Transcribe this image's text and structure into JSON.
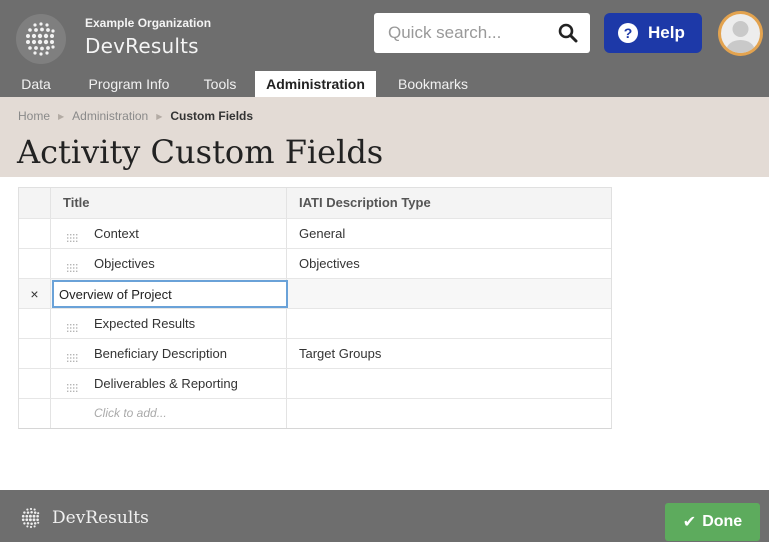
{
  "header": {
    "org_name": "Example Organization",
    "app_name": "DevResults",
    "search_placeholder": "Quick search...",
    "help_label": "Help"
  },
  "nav": {
    "items": [
      {
        "label": "Data",
        "active": false
      },
      {
        "label": "Program Info",
        "active": false
      },
      {
        "label": "Tools",
        "active": false
      },
      {
        "label": "Administration",
        "active": true
      },
      {
        "label": "Bookmarks",
        "active": false
      }
    ]
  },
  "breadcrumb": {
    "items": [
      "Home",
      "Administration",
      "Custom Fields"
    ]
  },
  "page": {
    "title": "Activity Custom Fields"
  },
  "table": {
    "columns": [
      "Title",
      "IATI Description Type"
    ],
    "rows": [
      {
        "title": "Context",
        "type": "General"
      },
      {
        "title": "Objectives",
        "type": "Objectives"
      },
      {
        "title": "Overview of Project",
        "type": "",
        "editing": true
      },
      {
        "title": "Expected Results",
        "type": ""
      },
      {
        "title": "Beneficiary Description",
        "type": "Target Groups"
      },
      {
        "title": "Deliverables & Reporting",
        "type": ""
      }
    ],
    "add_placeholder": "Click to add...",
    "remove_glyph": "×"
  },
  "footer": {
    "brand": "DevResults",
    "done_label": "Done"
  },
  "colors": {
    "header_bg": "#6e6e6e",
    "help_button": "#1d39a8",
    "done_button": "#5dab5d",
    "band_bg": "#e3dbd5",
    "edit_border": "#6aa2d8"
  }
}
